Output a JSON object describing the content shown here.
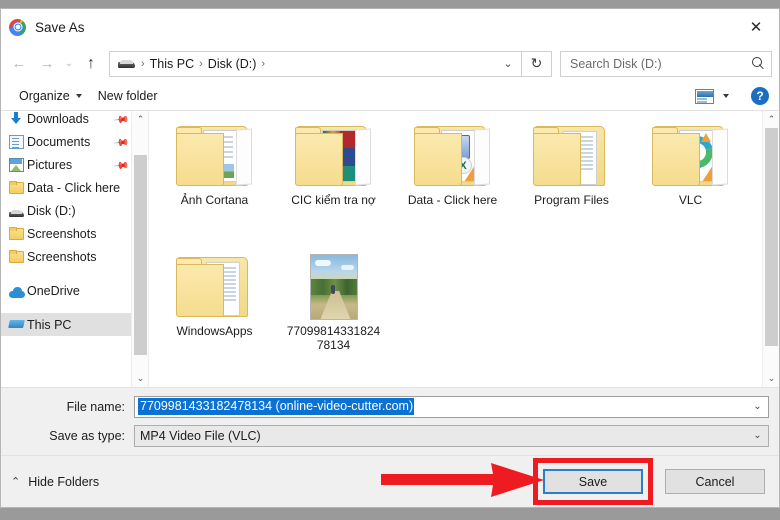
{
  "window": {
    "title": "Save As",
    "app_icon": "chrome-icon",
    "close_label": "✕"
  },
  "nav": {
    "back_label": "←",
    "forward_label": "→",
    "history_label": "⌄",
    "up_label": "↑",
    "breadcrumb": {
      "drive_icon": "drive-icon",
      "items": [
        "This PC",
        "Disk (D:)"
      ],
      "separator": "›",
      "dropdown_label": "⌄"
    },
    "refresh_label": "↻",
    "search": {
      "placeholder": "Search Disk (D:)",
      "value": "",
      "icon": "search-icon"
    }
  },
  "toolbar": {
    "organize_label": "Organize",
    "new_folder_label": "New folder",
    "view_icon": "view-options-icon",
    "view_caret": "▾",
    "help_label": "?"
  },
  "sidebar": {
    "items": [
      {
        "label": "Downloads",
        "icon": "download-icon",
        "pinned": true,
        "selected": false,
        "indent": false
      },
      {
        "label": "Documents",
        "icon": "document-icon",
        "pinned": true,
        "selected": false,
        "indent": false
      },
      {
        "label": "Pictures",
        "icon": "pictures-icon",
        "pinned": true,
        "selected": false,
        "indent": false
      },
      {
        "label": "Data - Click here",
        "icon": "folder-icon",
        "pinned": false,
        "selected": false,
        "indent": false
      },
      {
        "label": "Disk (D:)",
        "icon": "drive-icon",
        "pinned": false,
        "selected": false,
        "indent": false
      },
      {
        "label": "Screenshots",
        "icon": "folder-icon",
        "pinned": false,
        "selected": false,
        "indent": false
      },
      {
        "label": "Screenshots",
        "icon": "folder-icon",
        "pinned": false,
        "selected": false,
        "indent": false
      },
      {
        "label": "OneDrive",
        "icon": "cloud-icon",
        "pinned": false,
        "selected": false,
        "indent": false
      },
      {
        "label": "This PC",
        "icon": "this-pc-icon",
        "pinned": false,
        "selected": true,
        "indent": false
      }
    ],
    "scroll_up": "⌃",
    "scroll_down": "⌄"
  },
  "files": [
    {
      "name": "Ảnh Cortana",
      "type": "folder",
      "art": "cortana"
    },
    {
      "name": "CIC kiểm tra nợ",
      "type": "folder",
      "art": "cic"
    },
    {
      "name": "Data - Click here",
      "type": "folder",
      "art": "excel"
    },
    {
      "name": "Program Files",
      "type": "folder",
      "art": "plain"
    },
    {
      "name": "VLC",
      "type": "folder",
      "art": "vlc"
    },
    {
      "name": "WindowsApps",
      "type": "folder",
      "art": "plain"
    },
    {
      "name": "77099814331824 78134",
      "type": "video"
    }
  ],
  "fields": {
    "file_name_label": "File name:",
    "file_name_value": "7709981433182478134 (online-video-cutter.com)",
    "file_name_selected": true,
    "save_as_type_label": "Save as type:",
    "save_as_type_value": "MP4 Video File (VLC)",
    "dropdown_label": "⌄"
  },
  "footer": {
    "hide_folders_label": "Hide Folders",
    "hide_folders_chevron": "⌃",
    "save_label": "Save",
    "cancel_label": "Cancel"
  },
  "annotations": {
    "highlight_color": "#ee1c21",
    "target": "save-button"
  }
}
